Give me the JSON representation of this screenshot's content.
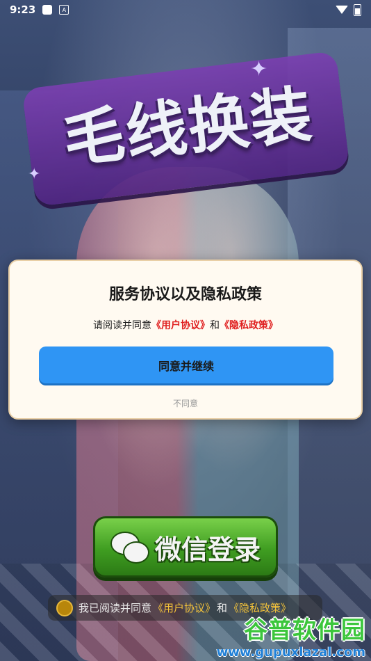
{
  "status_bar": {
    "time": "9:23",
    "notification_icon_2": "A"
  },
  "game": {
    "title": "毛线换装"
  },
  "dialog": {
    "title": "服务协议以及隐私政策",
    "desc_prefix": "请阅读并同意",
    "user_agreement": "《用户协议》",
    "and": "和",
    "privacy_policy": "《隐私政策》",
    "agree_button": "同意并继续",
    "disagree_button": "不同意"
  },
  "login": {
    "wechat_label": "微信登录",
    "agreement_prefix": "我已阅读并同意",
    "user_agreement": "《用户协议》",
    "and": "和",
    "privacy_policy": "《隐私政策》"
  },
  "watermark": {
    "title": "谷普软件园",
    "url": "www.gupuxlazal.com"
  },
  "colors": {
    "primary_button": "#2f95f4",
    "link": "#e02020",
    "wechat_green": "#3f9d21",
    "dialog_bg": "#fffaf1"
  }
}
